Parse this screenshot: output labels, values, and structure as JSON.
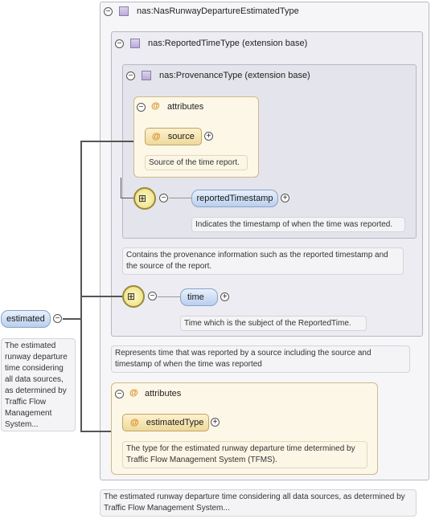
{
  "root": {
    "title": "nas:NasRunwayDepartureEstimatedType",
    "note": "The estimated runway departure time considering all data sources, as determined by Traffic Flow Management System..."
  },
  "estimated_element": {
    "label": "estimated",
    "note": "The estimated runway departure time considering all data sources, as determined by Traffic Flow Management System..."
  },
  "reported_time": {
    "title": "nas:ReportedTimeType (extension base)",
    "note": "Represents time that was reported by a source including the source and timestamp of when the time was reported"
  },
  "provenance": {
    "title": "nas:ProvenanceType (extension base)",
    "note": "Contains the provenance information such as the reported timestamp and the source of the report.",
    "attributes_label": "attributes",
    "source_label": "source",
    "source_note": "Source of the time report.",
    "reported_timestamp_label": "reportedTimestamp",
    "reported_timestamp_note": "Indicates the timestamp of when the time was reported."
  },
  "time_element": {
    "label": "time",
    "note": "Time which is the subject of the ReportedTime."
  },
  "root_attributes": {
    "label": "attributes",
    "estimated_type_label": "estimatedType",
    "estimated_type_note": "The type for the estimated runway departure time determined by Traffic Flow Management System (TFMS)."
  },
  "colors": {
    "panel_border": "#b8b8c4",
    "attribute_accent": "#d08a1a",
    "element_blue": "#b9cfee"
  }
}
